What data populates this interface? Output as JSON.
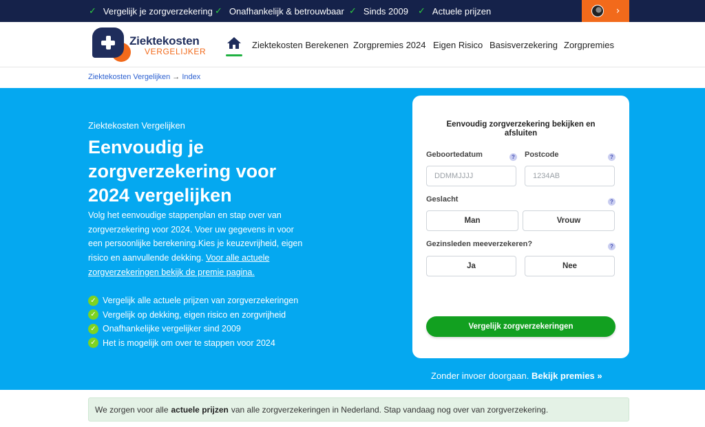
{
  "topbar": {
    "usps": [
      "Vergelijk je zorgverzekering",
      "Onafhankelijk & betrouwbaar",
      "Sinds 2009",
      "Actuele prijzen"
    ],
    "check_icon": "check-icon",
    "account_chevron": "›"
  },
  "logo": {
    "line1": "Ziektekosten",
    "line2": "VERGELIJKER"
  },
  "nav": {
    "home_icon": "home-icon",
    "items": [
      "Ziektekosten Berekenen",
      "Zorgpremies 2024",
      "Eigen Risico",
      "Basisverzekering",
      "Zorgpremies"
    ]
  },
  "breadcrumb": {
    "root": "Ziektekosten Vergelijken",
    "separator": "→",
    "current": "Index"
  },
  "hero": {
    "eyebrow": "Ziektekosten Vergelijken",
    "title": "Eenvoudig je zorgverzekering voor 2024 vergelijken",
    "intro": "Volg het eenvoudige stappenplan en stap over van zorgverzekering voor 2024. Voer uw gegevens in voor een persoonlijke berekening.Kies je keuzevrijheid, eigen risico en aanvullende dekking.",
    "intro_link": "Voor alle actuele zorgverzekeringen bekijk de premie pagina.",
    "bullets": [
      "Vergelijk alle actuele prijzen van zorgverzekeringen",
      "Vergelijk op dekking, eigen risico en zorgvrijheid",
      "Onafhankelijke vergelijker sind 2009",
      "Het is mogelijk om over te stappen voor 2024"
    ]
  },
  "form": {
    "title": "Eenvoudig zorgverzekering bekijken en afsluiten",
    "birthdate_label": "Geboortedatum",
    "birthdate_placeholder": "DDMMJJJJ",
    "postcode_label": "Postcode",
    "postcode_placeholder": "1234AB",
    "gender_label": "Geslacht",
    "gender_options": [
      "Man",
      "Vrouw"
    ],
    "family_label": "Gezinsleden meeverzekeren?",
    "family_options": [
      "Ja",
      "Nee"
    ],
    "help_glyph": "?",
    "submit_label": "Vergelijk zorgverzekeringen"
  },
  "skip": {
    "text": "Zonder invoer doorgaan.",
    "link": "Bekijk premies »"
  },
  "notice": {
    "before": "We zorgen voor alle",
    "bold": "actuele prijzen",
    "after": "van alle zorgverzekeringen in Nederland. Stap vandaag nog over van zorgverzekering."
  },
  "colors": {
    "topbar_bg": "#15224a",
    "accent_orange": "#f26a1b",
    "hero_bg": "#05a8f0",
    "cta_green": "#12a020",
    "notice_bg": "#e4f2e6"
  }
}
